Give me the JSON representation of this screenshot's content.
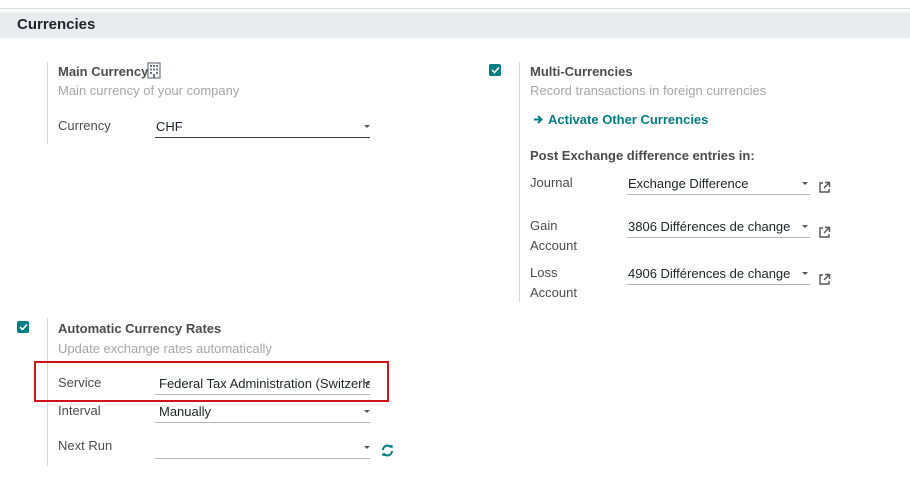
{
  "section": {
    "title": "Currencies"
  },
  "main_currency": {
    "title": "Main Currency",
    "description": "Main currency of your company",
    "currency_label": "Currency",
    "currency_value": "CHF"
  },
  "multi_currencies": {
    "title": "Multi-Currencies",
    "description": "Record transactions in foreign currencies",
    "activate_link": "Activate Other Currencies",
    "post_heading": "Post Exchange difference entries in:",
    "journal_label": "Journal",
    "journal_value": "Exchange Difference",
    "gain_label_line1": "Gain",
    "gain_label_line2": "Account",
    "gain_value": "3806 Différences de change",
    "loss_label_line1": "Loss",
    "loss_label_line2": "Account",
    "loss_value": "4906 Différences de change"
  },
  "auto_rates": {
    "title": "Automatic Currency Rates",
    "description": "Update exchange rates automatically",
    "service_label": "Service",
    "service_value": "Federal Tax Administration (Switzerland)",
    "interval_label": "Interval",
    "interval_value": "Manually",
    "next_run_label": "Next Run",
    "next_run_value": ""
  },
  "colors": {
    "accent": "#017e84",
    "highlight": "#d0131a"
  }
}
